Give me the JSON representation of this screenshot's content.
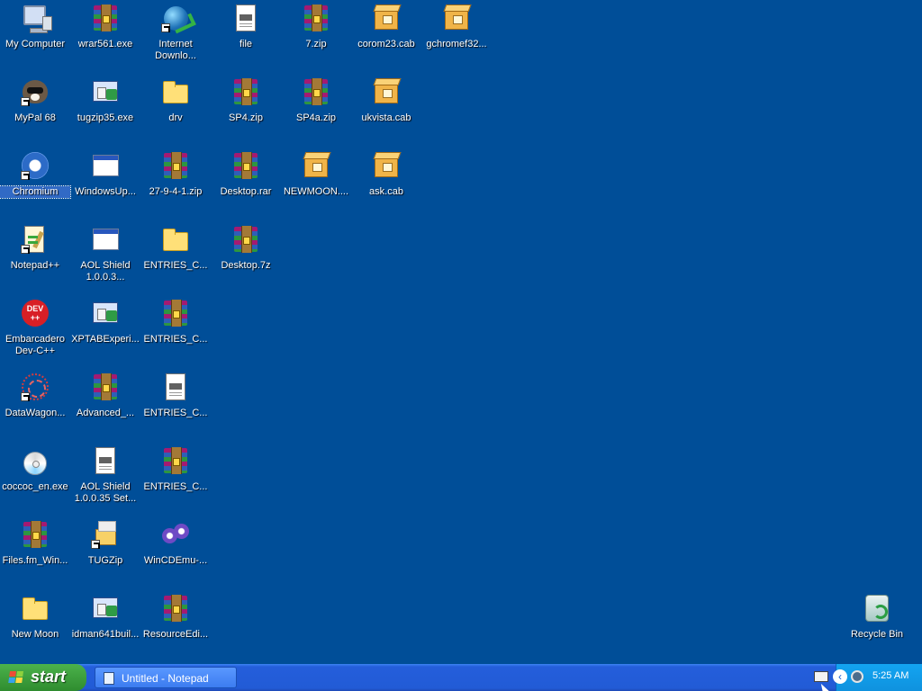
{
  "desktop": {
    "icons": [
      {
        "label": "My Computer",
        "icon": "my-computer-icon"
      },
      {
        "label": "wrar561.exe",
        "icon": "winrar-archive-icon"
      },
      {
        "label": "Internet Downlo...",
        "icon": "internet-download-manager-shortcut-icon"
      },
      {
        "label": "file",
        "icon": "text-file-icon"
      },
      {
        "label": "7.zip",
        "icon": "winrar-archive-icon"
      },
      {
        "label": "corom23.cab",
        "icon": "cab-file-icon"
      },
      {
        "label": "gchromef32...",
        "icon": "cab-file-icon"
      },
      {
        "label": "MyPal 68",
        "icon": "mypal-browser-shortcut-icon"
      },
      {
        "label": "tugzip35.exe",
        "icon": "installer-icon"
      },
      {
        "label": "drv",
        "icon": "folder-icon"
      },
      {
        "label": "SP4.zip",
        "icon": "winrar-archive-icon"
      },
      {
        "label": "SP4a.zip",
        "icon": "winrar-archive-icon"
      },
      {
        "label": "ukvista.cab",
        "icon": "cab-file-icon"
      },
      {
        "label": "Chromium",
        "icon": "chromium-shortcut-icon",
        "selected": true
      },
      {
        "label": "WindowsUp...",
        "icon": "window-application-icon"
      },
      {
        "label": "27-9-4-1.zip",
        "icon": "winrar-archive-icon"
      },
      {
        "label": "Desktop.rar",
        "icon": "winrar-archive-icon"
      },
      {
        "label": "NEWMOON....",
        "icon": "cab-file-icon"
      },
      {
        "label": "ask.cab",
        "icon": "cab-file-icon"
      },
      {
        "label": "Notepad++",
        "icon": "notepad-plus-plus-shortcut-icon"
      },
      {
        "label": "AOL Shield 1.0.0.3...",
        "icon": "window-application-icon"
      },
      {
        "label": "ENTRIES_C...",
        "icon": "folder-icon"
      },
      {
        "label": "Desktop.7z",
        "icon": "winrar-archive-icon"
      },
      {
        "label": "Embarcadero Dev-C++",
        "icon": "dev-cpp-icon"
      },
      {
        "label": "XPTABExperi...",
        "icon": "installer-icon"
      },
      {
        "label": "ENTRIES_C...",
        "icon": "winrar-archive-icon"
      },
      {
        "label": "DataWagon...",
        "icon": "datawagon-shortcut-icon"
      },
      {
        "label": "Advanced_...",
        "icon": "winrar-archive-icon"
      },
      {
        "label": "ENTRIES_C...",
        "icon": "text-file-icon"
      },
      {
        "label": "coccoc_en.exe",
        "icon": "coccoc-installer-icon"
      },
      {
        "label": "AOL Shield 1.0.0.35 Set...",
        "icon": "text-file-icon"
      },
      {
        "label": "ENTRIES_C...",
        "icon": "winrar-archive-icon"
      },
      {
        "label": "Files.fm_Win...",
        "icon": "winrar-archive-icon"
      },
      {
        "label": "TUGZip",
        "icon": "tugzip-shortcut-icon"
      },
      {
        "label": "WinCDEmu-...",
        "icon": "wincdemu-icon"
      },
      {
        "label": "New Moon",
        "icon": "folder-icon"
      },
      {
        "label": "idman641buil...",
        "icon": "idm-installer-icon"
      },
      {
        "label": "ResourceEdi...",
        "icon": "winrar-archive-icon"
      },
      {
        "label": "Recycle Bin",
        "icon": "recycle-bin-icon"
      }
    ]
  },
  "taskbar": {
    "start_label": "start",
    "tasks": [
      {
        "label": "Untitled - Notepad",
        "icon": "notepad-icon"
      }
    ],
    "tray": {
      "clock": "5:25 AM"
    }
  },
  "colors": {
    "desktop_background": "#004e98",
    "taskbar_blue": "#245edb",
    "start_green": "#3a9e3a",
    "tray_blue": "#0f92de",
    "selected_label": "#316ac5"
  }
}
